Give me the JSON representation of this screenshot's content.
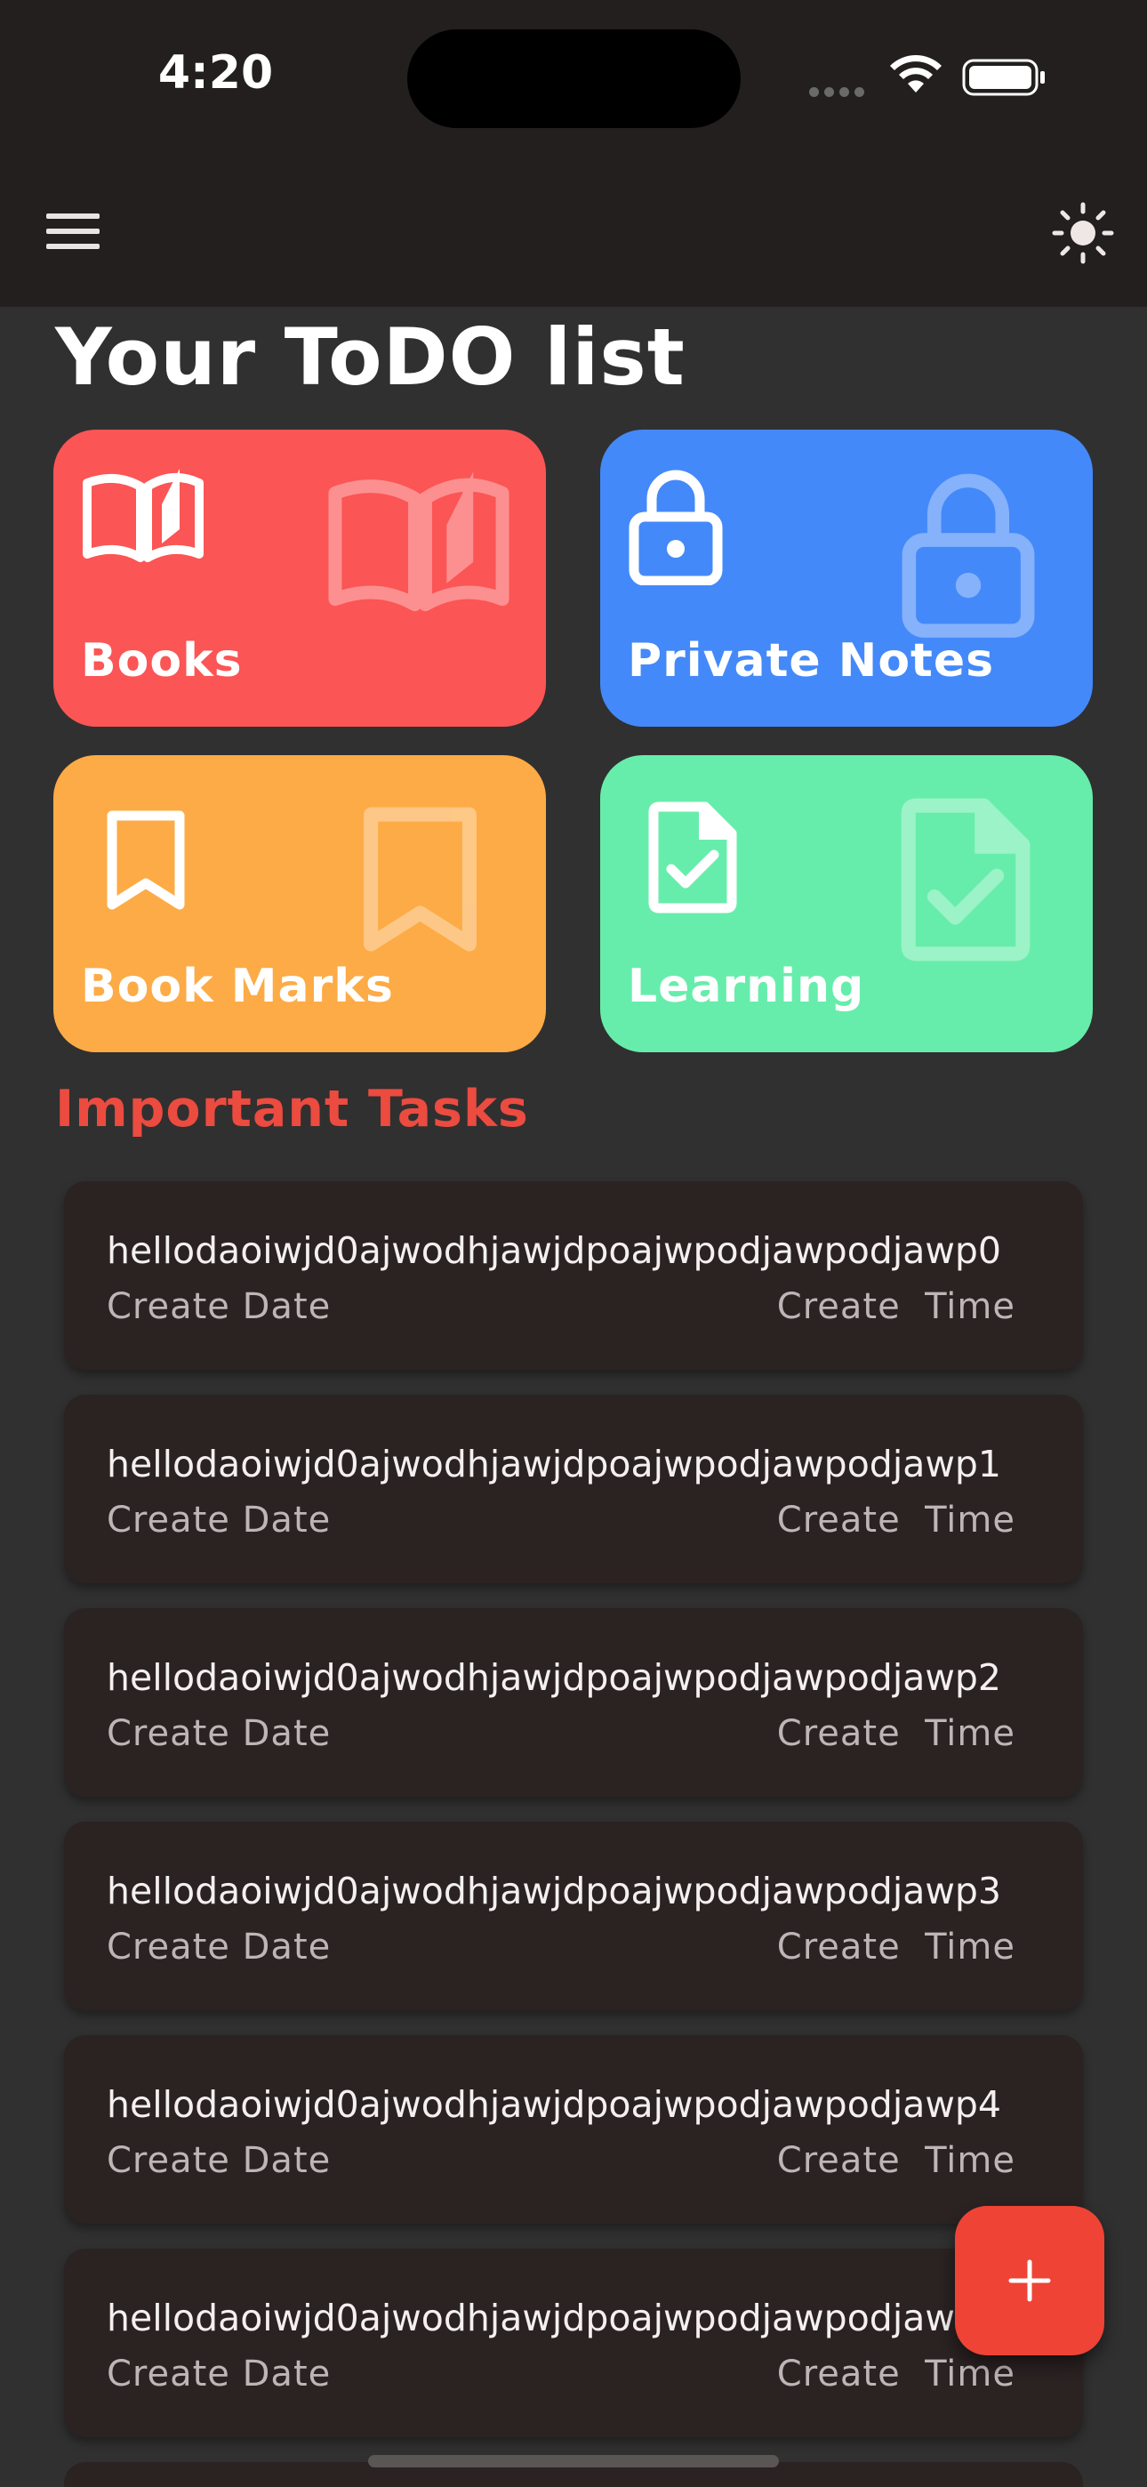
{
  "status_bar": {
    "time": "4:20"
  },
  "header": {
    "menu_icon": "hamburger-menu-icon",
    "theme_icon": "sun-icon"
  },
  "page": {
    "title": "Your ToDO list"
  },
  "categories": [
    {
      "label": "Books",
      "icon": "open-book-icon",
      "color": "#fb5555"
    },
    {
      "label": "Private Notes",
      "icon": "lock-icon",
      "color": "#4489f9"
    },
    {
      "label": "Book Marks",
      "icon": "bookmark-icon",
      "color": "#fdab46"
    },
    {
      "label": "Learning",
      "icon": "document-check-icon",
      "color": "#67edab"
    }
  ],
  "section": {
    "title": "Important Tasks",
    "color": "#ec4b40"
  },
  "tasks": [
    {
      "title": "hellodaoiwjd0ajwodhjawjdpoajwpodjawpodjawp0",
      "date_label": "Create Date",
      "time_label": "Create  Time"
    },
    {
      "title": "hellodaoiwjd0ajwodhjawjdpoajwpodjawpodjawp1",
      "date_label": "Create Date",
      "time_label": "Create  Time"
    },
    {
      "title": "hellodaoiwjd0ajwodhjawjdpoajwpodjawpodjawp2",
      "date_label": "Create Date",
      "time_label": "Create  Time"
    },
    {
      "title": "hellodaoiwjd0ajwodhjawjdpoajwpodjawpodjawp3",
      "date_label": "Create Date",
      "time_label": "Create  Time"
    },
    {
      "title": "hellodaoiwjd0ajwodhjawjdpoajwpodjawpodjawp4",
      "date_label": "Create Date",
      "time_label": "Create  Time"
    },
    {
      "title": "hellodaoiwjd0ajwodhjawjdpoajwpodjawpodjawp5",
      "date_label": "Create Date",
      "time_label": "Create  Time"
    }
  ],
  "fab": {
    "icon": "plus-icon",
    "color": "#ef4336"
  },
  "colors": {
    "background": "#303030",
    "app_bar": "#231f1f",
    "task_card": "#2b2222"
  }
}
